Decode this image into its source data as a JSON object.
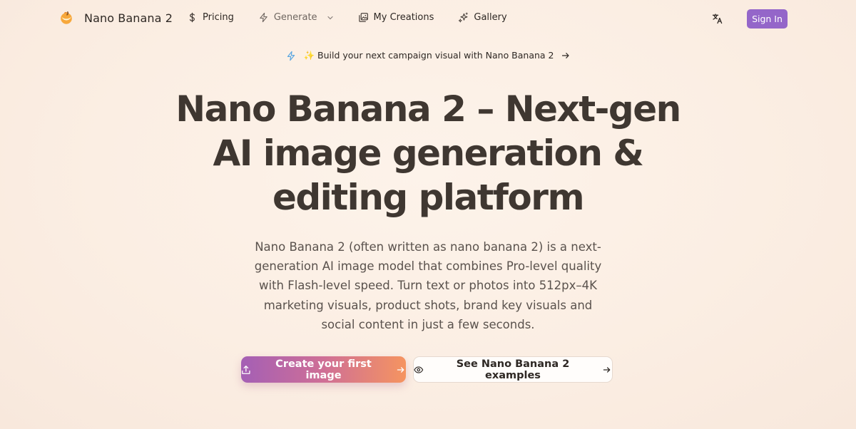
{
  "brand": {
    "name": "Nano Banana 2",
    "logo_icon": "banana-logo-icon"
  },
  "nav": {
    "items": [
      {
        "label": "Pricing",
        "icon": "dollar-icon"
      },
      {
        "label": "Generate",
        "icon": "lightning-icon"
      },
      {
        "label": "My Creations",
        "icon": "images-icon"
      },
      {
        "label": "Gallery",
        "icon": "sparkles-icon"
      }
    ],
    "translate_icon": "translate-icon",
    "signin_label": "Sign In"
  },
  "announcement": {
    "text": "✨ Build your next campaign visual with Nano Banana 2"
  },
  "hero": {
    "title": "Nano Banana 2 – Next-gen AI image generation & editing platform",
    "description": "Nano Banana 2 (often written as nano banana 2) is a next-generation AI image model that combines Pro-level quality with Flash-level speed. Turn text or photos into 512px–4K marketing visuals, product shots, brand key visuals and social content in just a few seconds."
  },
  "cta": {
    "primary_label": "Create your first image",
    "secondary_label": "See Nano Banana 2 examples"
  },
  "colors": {
    "accent": "#9466c9",
    "gradient_start": "#a45fb5",
    "gradient_end": "#f59460",
    "background": "#fbeee3",
    "text": "#3f3731"
  }
}
